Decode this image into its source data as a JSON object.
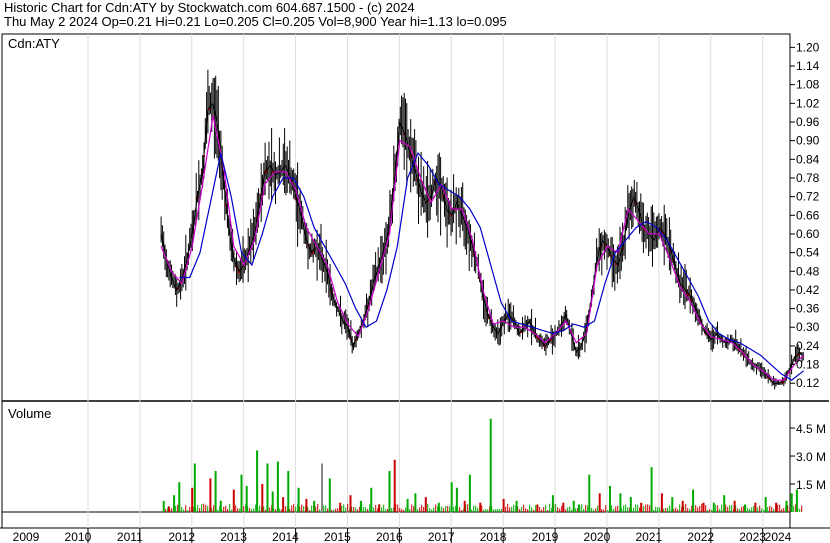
{
  "header": {
    "line1": "Historic Chart for Cdn:ATY  by Stockwatch.com 604.687.1500 - (c) 2024",
    "line2": "Thu May  2 2024  Op=0.21  Hi=0.21  Lo=0.205  Cl=0.205  Vol=8,900  Year hi=1.13  lo=0.095"
  },
  "chart_data": [
    {
      "type": "line",
      "title": "Cdn:ATY",
      "ylim": [
        0.095,
        1.23
      ],
      "y_ticks": [
        "1.20",
        "1.14",
        "1.08",
        "1.02",
        "0.96",
        "0.90",
        "0.84",
        "0.78",
        "0.72",
        "0.66",
        "0.60",
        "0.54",
        "0.48",
        "0.42",
        "0.36",
        "0.30",
        "0.24",
        "0.18",
        "0.12"
      ],
      "x_ticks": [
        "2009",
        "2010",
        "2011",
        "2012",
        "2013",
        "2014",
        "2015",
        "2016",
        "2017",
        "2018",
        "2019",
        "2020",
        "2021",
        "2022",
        "2023",
        "2024"
      ],
      "series": [
        {
          "color": "#000000",
          "x": [
            2011.95,
            2012.05,
            2012.15,
            2012.25,
            2012.35,
            2012.45,
            2012.55,
            2012.65,
            2012.75,
            2012.85,
            2012.95,
            2013.05,
            2013.15,
            2013.25,
            2013.35,
            2013.45,
            2013.55,
            2013.65,
            2013.75,
            2013.85,
            2013.95,
            2014.05,
            2014.15,
            2014.25,
            2014.35,
            2014.45,
            2014.55,
            2014.65,
            2014.75,
            2014.85,
            2014.95,
            2015.05,
            2015.15,
            2015.25,
            2015.35,
            2015.45,
            2015.55,
            2015.65,
            2015.75,
            2015.85,
            2015.95,
            2016.05,
            2016.15,
            2016.25,
            2016.35,
            2016.45,
            2016.55,
            2016.65,
            2016.75,
            2016.85,
            2016.95,
            2017.05,
            2017.15,
            2017.25,
            2017.35,
            2017.45,
            2017.55,
            2017.65,
            2017.75,
            2017.85,
            2017.95,
            2018.05,
            2018.15,
            2018.25,
            2018.35,
            2018.45,
            2018.55,
            2018.65,
            2018.75,
            2018.85,
            2018.95,
            2019.05,
            2019.15,
            2019.25,
            2019.35,
            2019.45,
            2019.55,
            2019.65,
            2019.75,
            2019.85,
            2019.95,
            2020.05,
            2020.15,
            2020.25,
            2020.35,
            2020.45,
            2020.55,
            2020.65,
            2020.75,
            2020.85,
            2020.95,
            2021.05,
            2021.15,
            2021.25,
            2021.35,
            2021.45,
            2021.55,
            2021.65,
            2021.75,
            2021.85,
            2021.95,
            2022.05,
            2022.15,
            2022.25,
            2022.35,
            2022.45,
            2022.55,
            2022.65,
            2022.75,
            2022.85,
            2022.95,
            2023.05,
            2023.15,
            2023.25,
            2023.35,
            2023.45,
            2023.55,
            2023.65,
            2023.75,
            2023.85,
            2023.95,
            2024.05,
            2024.15,
            2024.25,
            2024.33
          ],
          "y": [
            0.6,
            0.52,
            0.46,
            0.42,
            0.45,
            0.52,
            0.6,
            0.72,
            0.8,
            1.0,
            1.02,
            0.94,
            0.78,
            0.62,
            0.52,
            0.48,
            0.5,
            0.55,
            0.6,
            0.7,
            0.8,
            0.82,
            0.79,
            0.8,
            0.82,
            0.78,
            0.72,
            0.66,
            0.58,
            0.54,
            0.56,
            0.52,
            0.48,
            0.4,
            0.36,
            0.32,
            0.3,
            0.24,
            0.28,
            0.32,
            0.38,
            0.45,
            0.5,
            0.55,
            0.62,
            0.78,
            0.96,
            0.92,
            0.86,
            0.8,
            0.74,
            0.7,
            0.72,
            0.78,
            0.75,
            0.68,
            0.66,
            0.7,
            0.66,
            0.62,
            0.56,
            0.5,
            0.4,
            0.34,
            0.3,
            0.28,
            0.32,
            0.34,
            0.32,
            0.28,
            0.3,
            0.32,
            0.28,
            0.26,
            0.24,
            0.26,
            0.28,
            0.3,
            0.34,
            0.28,
            0.22,
            0.24,
            0.3,
            0.4,
            0.52,
            0.58,
            0.56,
            0.52,
            0.5,
            0.56,
            0.66,
            0.72,
            0.68,
            0.62,
            0.6,
            0.58,
            0.62,
            0.6,
            0.56,
            0.5,
            0.44,
            0.42,
            0.4,
            0.36,
            0.32,
            0.28,
            0.26,
            0.28,
            0.26,
            0.25,
            0.26,
            0.24,
            0.22,
            0.2,
            0.18,
            0.17,
            0.16,
            0.14,
            0.12,
            0.12,
            0.13,
            0.16,
            0.2,
            0.22,
            0.205
          ]
        },
        {
          "color": "#cc00cc",
          "x": [
            2011.95,
            2012.15,
            2012.35,
            2012.55,
            2012.75,
            2012.95,
            2013.15,
            2013.35,
            2013.55,
            2013.75,
            2013.95,
            2014.15,
            2014.35,
            2014.55,
            2014.75,
            2014.95,
            2015.15,
            2015.35,
            2015.55,
            2015.75,
            2015.95,
            2016.15,
            2016.35,
            2016.55,
            2016.75,
            2016.95,
            2017.15,
            2017.35,
            2017.55,
            2017.75,
            2017.95,
            2018.15,
            2018.35,
            2018.55,
            2018.75,
            2018.95,
            2019.15,
            2019.35,
            2019.55,
            2019.75,
            2019.95,
            2020.15,
            2020.35,
            2020.55,
            2020.75,
            2020.95,
            2021.15,
            2021.35,
            2021.55,
            2021.75,
            2021.95,
            2022.15,
            2022.35,
            2022.55,
            2022.75,
            2022.95,
            2023.15,
            2023.35,
            2023.55,
            2023.75,
            2023.95,
            2024.15,
            2024.33
          ],
          "y": [
            0.56,
            0.48,
            0.44,
            0.56,
            0.76,
            0.98,
            0.82,
            0.56,
            0.5,
            0.58,
            0.76,
            0.8,
            0.8,
            0.74,
            0.62,
            0.56,
            0.5,
            0.38,
            0.31,
            0.27,
            0.36,
            0.48,
            0.6,
            0.9,
            0.88,
            0.78,
            0.7,
            0.76,
            0.68,
            0.68,
            0.58,
            0.42,
            0.31,
            0.32,
            0.3,
            0.3,
            0.28,
            0.25,
            0.28,
            0.32,
            0.25,
            0.28,
            0.5,
            0.56,
            0.54,
            0.68,
            0.64,
            0.6,
            0.6,
            0.52,
            0.43,
            0.38,
            0.31,
            0.27,
            0.26,
            0.25,
            0.22,
            0.18,
            0.16,
            0.13,
            0.13,
            0.18,
            0.21
          ]
        },
        {
          "color": "#0000cc",
          "x": [
            2012.3,
            2012.5,
            2012.7,
            2012.9,
            2013.1,
            2013.3,
            2013.5,
            2013.7,
            2013.9,
            2014.1,
            2014.3,
            2014.5,
            2014.7,
            2014.9,
            2015.1,
            2015.3,
            2015.5,
            2015.7,
            2015.9,
            2016.1,
            2016.3,
            2016.5,
            2016.7,
            2016.9,
            2017.1,
            2017.3,
            2017.5,
            2017.7,
            2017.9,
            2018.1,
            2018.3,
            2018.5,
            2018.7,
            2018.9,
            2019.1,
            2019.3,
            2019.5,
            2019.7,
            2019.9,
            2020.1,
            2020.3,
            2020.5,
            2020.7,
            2020.9,
            2021.1,
            2021.3,
            2021.5,
            2021.7,
            2021.9,
            2022.1,
            2022.3,
            2022.5,
            2022.7,
            2022.9,
            2023.1,
            2023.3,
            2023.5,
            2023.7,
            2023.9,
            2024.1,
            2024.33
          ],
          "y": [
            0.46,
            0.46,
            0.54,
            0.7,
            0.86,
            0.72,
            0.54,
            0.5,
            0.6,
            0.72,
            0.78,
            0.78,
            0.72,
            0.62,
            0.56,
            0.5,
            0.44,
            0.36,
            0.3,
            0.32,
            0.42,
            0.56,
            0.78,
            0.86,
            0.82,
            0.76,
            0.74,
            0.72,
            0.68,
            0.62,
            0.5,
            0.38,
            0.32,
            0.31,
            0.3,
            0.29,
            0.28,
            0.29,
            0.31,
            0.3,
            0.32,
            0.44,
            0.54,
            0.58,
            0.62,
            0.64,
            0.62,
            0.58,
            0.52,
            0.46,
            0.4,
            0.32,
            0.28,
            0.26,
            0.25,
            0.23,
            0.21,
            0.18,
            0.15,
            0.13,
            0.16
          ]
        }
      ]
    },
    {
      "type": "bar",
      "title": "Volume",
      "ylim": [
        0,
        5.2
      ],
      "y_ticks": [
        "4.5 M",
        "3.0 M",
        "1.5 M"
      ],
      "colors": {
        "up": "#00aa00",
        "down": "#cc0000",
        "flat": "#888888"
      },
      "x": [
        2012.0,
        2012.1,
        2012.2,
        2012.3,
        2012.55,
        2012.6,
        2012.9,
        2013.0,
        2013.1,
        2013.35,
        2013.5,
        2013.6,
        2013.8,
        2013.9,
        2014.0,
        2014.1,
        2014.2,
        2014.3,
        2014.4,
        2014.6,
        2014.75,
        2014.9,
        2015.05,
        2015.2,
        2015.4,
        2015.6,
        2015.8,
        2016.0,
        2016.15,
        2016.35,
        2016.45,
        2016.7,
        2016.85,
        2017.05,
        2017.3,
        2017.55,
        2017.65,
        2017.8,
        2017.9,
        2018.1,
        2018.3,
        2018.55,
        2018.8,
        2019.2,
        2019.5,
        2019.7,
        2019.9,
        2020.0,
        2020.2,
        2020.4,
        2020.6,
        2020.8,
        2021.0,
        2021.2,
        2021.4,
        2021.6,
        2021.8,
        2022.0,
        2022.2,
        2022.4,
        2022.6,
        2022.8,
        2023.0,
        2023.2,
        2023.4,
        2023.6,
        2023.8,
        2024.0,
        2024.1,
        2024.2
      ],
      "values": [
        0.6,
        0.3,
        0.9,
        1.6,
        1.3,
        2.6,
        1.8,
        2.2,
        0.6,
        1.2,
        2.0,
        1.4,
        3.3,
        1.5,
        2.6,
        1.1,
        2.7,
        0.8,
        2.2,
        1.3,
        0.7,
        0.6,
        2.6,
        1.8,
        0.5,
        0.9,
        0.6,
        1.3,
        0.4,
        2.2,
        2.8,
        0.7,
        1.0,
        0.8,
        0.5,
        1.6,
        1.3,
        0.6,
        2.0,
        0.5,
        5.0,
        0.7,
        0.6,
        0.4,
        0.9,
        0.5,
        0.6,
        0.4,
        2.0,
        1.0,
        1.4,
        1.0,
        0.8,
        0.5,
        2.4,
        1.0,
        0.8,
        0.6,
        1.2,
        0.5,
        0.5,
        0.9,
        0.6,
        0.4,
        0.5,
        0.8,
        0.5,
        0.6,
        1.0,
        1.2
      ],
      "dirs": [
        "up",
        "down",
        "up",
        "up",
        "down",
        "up",
        "down",
        "up",
        "up",
        "down",
        "up",
        "up",
        "up",
        "down",
        "up",
        "up",
        "up",
        "down",
        "up",
        "up",
        "down",
        "up",
        "flat",
        "up",
        "down",
        "down",
        "up",
        "up",
        "down",
        "up",
        "down",
        "up",
        "up",
        "down",
        "up",
        "up",
        "up",
        "down",
        "up",
        "down",
        "up",
        "down",
        "up",
        "down",
        "up",
        "down",
        "up",
        "up",
        "up",
        "down",
        "up",
        "up",
        "up",
        "down",
        "up",
        "down",
        "up",
        "down",
        "up",
        "down",
        "up",
        "up",
        "down",
        "up",
        "down",
        "up",
        "down",
        "up",
        "up",
        "up"
      ]
    }
  ]
}
